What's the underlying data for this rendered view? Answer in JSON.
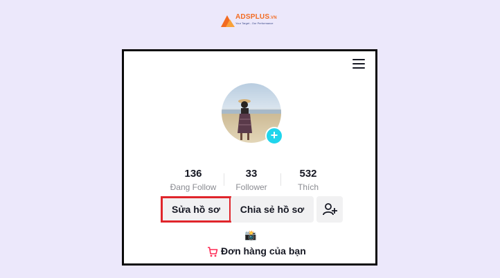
{
  "brand": {
    "name": "ADSPLUS",
    "suffix": ".VN",
    "tagline": "Your Target - Our Performance",
    "colors": {
      "orange": "#f26b21",
      "blue": "#3b4a8a"
    }
  },
  "profile": {
    "menu_icon": "hamburger-menu-icon",
    "add_icon": "plus-icon",
    "stats": [
      {
        "value": "136",
        "label": "Đang Follow"
      },
      {
        "value": "33",
        "label": "Follower"
      },
      {
        "value": "532",
        "label": "Thích"
      }
    ],
    "buttons": {
      "edit_profile": "Sửa hồ sơ",
      "share_profile": "Chia sẻ hồ sơ",
      "add_friend_icon": "add-user-icon"
    },
    "camera_emoji": "📸",
    "orders_label": "Đơn hàng của bạn",
    "orders_icon": "cart-icon",
    "colors": {
      "accent": "#20d5ec",
      "highlight": "#e0252b",
      "cart": "#fe2c55"
    }
  }
}
